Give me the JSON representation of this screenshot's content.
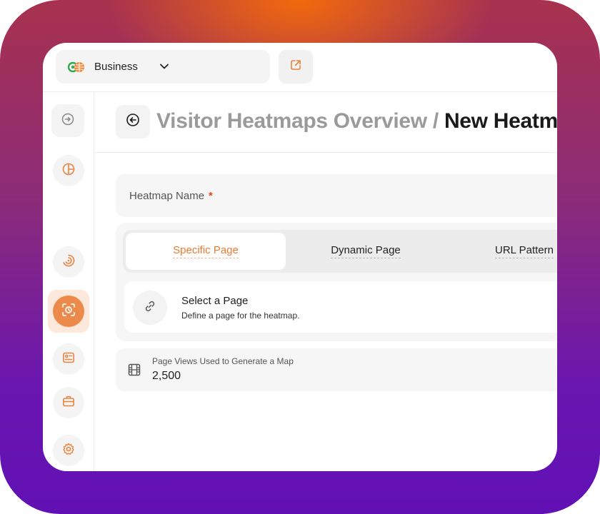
{
  "workspace": {
    "name": "Business",
    "logo_colors": {
      "green": "#34a853",
      "orange": "#f08a3a"
    }
  },
  "icons": {
    "workspace_chevron": "chevron-down-icon",
    "external": "external-link-icon",
    "back": "arrow-left-circle-icon",
    "link": "link-icon",
    "views": "film-icon"
  },
  "sidebar": {
    "items": [
      {
        "icon": "logout-icon",
        "active": false
      },
      {
        "icon": "pie-chart-icon",
        "active": false
      },
      {
        "icon": "radar-icon",
        "active": false
      },
      {
        "icon": "scan-heatmap-icon",
        "active": true
      },
      {
        "icon": "report-icon",
        "active": false
      },
      {
        "icon": "briefcase-icon",
        "active": false
      },
      {
        "icon": "gear-icon",
        "active": false
      },
      {
        "icon": "location-pin-icon",
        "active": false
      }
    ]
  },
  "header": {
    "breadcrumb": "Visitor Heatmaps Overview",
    "separator": "/",
    "current": "New Heatmap"
  },
  "form": {
    "name_label": "Heatmap Name",
    "required_mark": "*",
    "tabs": [
      {
        "label": "Specific Page",
        "active": true
      },
      {
        "label": "Dynamic Page",
        "active": false
      },
      {
        "label": "URL Pattern",
        "active": false
      }
    ],
    "select_title": "Select a Page",
    "select_desc": "Define a page for the heatmap.",
    "views_label": "Page Views Used to Generate a Map",
    "views_value": "2,500"
  },
  "colors": {
    "accent": "#ec7a2e",
    "accent_soft": "#fde8dc",
    "icon_orange": "#e9833f"
  }
}
